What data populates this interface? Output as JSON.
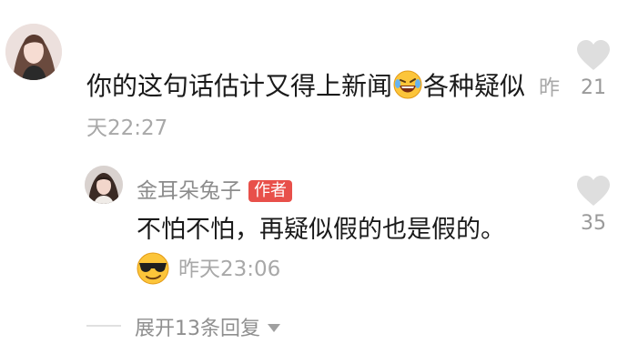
{
  "comment": {
    "text": "你的这句话估计又得上新闻",
    "text_after_emoji": "各种疑似",
    "time": "昨天22:27",
    "likes": "21"
  },
  "reply": {
    "username": "金耳朵兔子",
    "badge": "作者",
    "text": "不怕不怕，再疑似假的也是假的。",
    "time": "昨天23:06",
    "likes": "35"
  },
  "expand": {
    "label": "展开13条回复"
  },
  "icons": {
    "like": "heart-icon",
    "laugh": "rolling-laughing-emoji",
    "cool": "sunglasses-emoji",
    "expand": "caret-down-icon"
  },
  "colors": {
    "badge_bg": "#e8504a",
    "meta_text": "#a8a8a8",
    "like_icon": "#dedede"
  }
}
